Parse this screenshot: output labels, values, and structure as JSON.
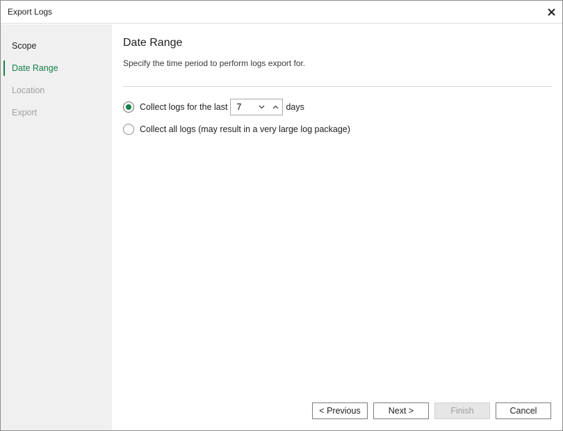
{
  "window": {
    "title": "Export Logs"
  },
  "sidebar": {
    "steps": [
      {
        "label": "Scope",
        "state": "done"
      },
      {
        "label": "Date Range",
        "state": "active"
      },
      {
        "label": "Location",
        "state": "pending"
      },
      {
        "label": "Export",
        "state": "pending"
      }
    ]
  },
  "main": {
    "heading": "Date Range",
    "description": "Specify the time period to perform logs export for.",
    "options": {
      "last_days_label": "Collect logs for the last",
      "last_days_value": "7",
      "days_suffix": "days",
      "all_logs_label": "Collect all logs (may result in a very large log package)",
      "selected": "last_days"
    }
  },
  "footer": {
    "previous": "< Previous",
    "next": "Next >",
    "finish": "Finish",
    "cancel": "Cancel"
  },
  "colors": {
    "accent": "#14804a",
    "sidebar_bg": "#f0f0f0"
  },
  "icons": {
    "close": "close-icon",
    "spin_down": "chevron-down-icon",
    "spin_up": "chevron-up-icon"
  }
}
